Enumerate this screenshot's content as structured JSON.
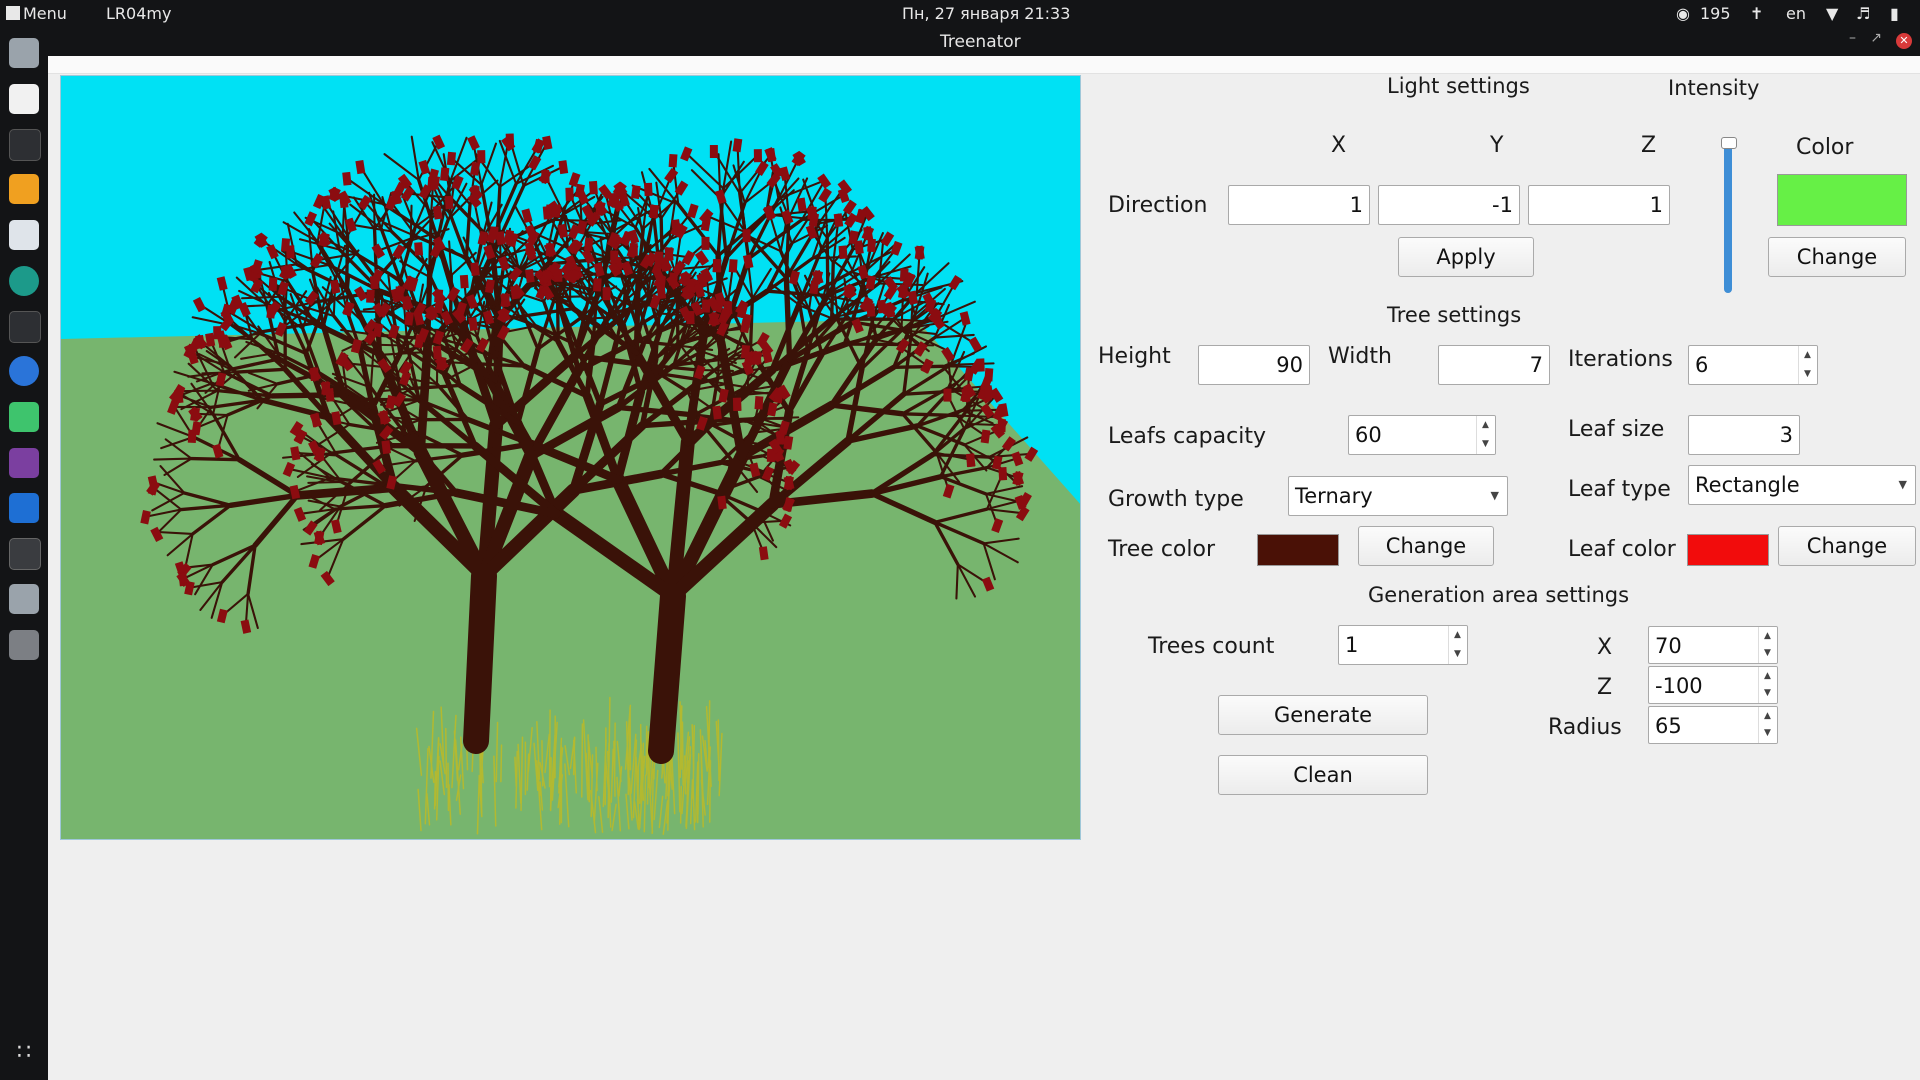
{
  "topbar": {
    "menu_label": "Menu",
    "session_label": "LR04my",
    "clock": "Пн, 27 января  21:33",
    "tray_count": "195",
    "keyboard_layout": "en"
  },
  "window": {
    "title": "Treenator"
  },
  "dock": {
    "icons": [
      "file-manager-icon",
      "pdf-viewer-icon",
      "terminal-icon",
      "downloader-icon",
      "messenger-icon",
      "chromium-icon",
      "terminal-icon",
      "firefox-icon",
      "qt-creator-icon",
      "slack-icon",
      "text-editor-icon",
      "terminal-active-icon",
      "file-manager-icon",
      "trash-icon",
      "apps-grid-icon"
    ]
  },
  "scene": {
    "sky_color": "#00e1f4",
    "ground_color": "#77b56e",
    "trunk_color": "#3a1208",
    "leaf_color": "#8b0c10",
    "grass_color": "#b3b930"
  },
  "light": {
    "title": "Light settings",
    "intensity_label": "Intensity",
    "x_label": "X",
    "y_label": "Y",
    "z_label": "Z",
    "direction_label": "Direction",
    "x_value": "1",
    "y_value": "-1",
    "z_value": "1",
    "apply_label": "Apply",
    "color_label": "Color",
    "color_value": "#66f046",
    "change_label": "Change",
    "intensity_level": 1.0
  },
  "tree": {
    "title": "Tree settings",
    "height_label": "Height",
    "height_value": "90",
    "width_label": "Width",
    "width_value": "7",
    "iterations_label": "Iterations",
    "iterations_value": "6",
    "leafs_capacity_label": "Leafs capacity",
    "leafs_capacity_value": "60",
    "leaf_size_label": "Leaf size",
    "leaf_size_value": "3",
    "growth_type_label": "Growth type",
    "growth_type_value": "Ternary",
    "leaf_type_label": "Leaf type",
    "leaf_type_value": "Rectangle",
    "tree_color_label": "Tree color",
    "tree_color_value": "#4a1106",
    "leaf_color_label": "Leaf color",
    "leaf_color_value": "#f20c0c",
    "change_label": "Change"
  },
  "generation": {
    "title": "Generation area settings",
    "trees_count_label": "Trees count",
    "trees_count_value": "1",
    "x_label": "X",
    "x_value": "70",
    "z_label": "Z",
    "z_value": "-100",
    "radius_label": "Radius",
    "radius_value": "65",
    "generate_label": "Generate",
    "clean_label": "Clean"
  }
}
